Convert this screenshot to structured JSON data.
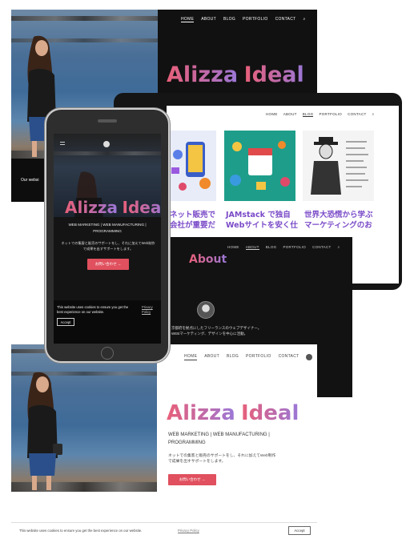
{
  "brand": {
    "first": "Alizza",
    "second": "Ideal"
  },
  "nav": {
    "home": "HOME",
    "about": "ABOUT",
    "blog": "BLOG",
    "portfolio": "PORTFOLIO",
    "contact": "CONTACT"
  },
  "desktop_top": {
    "strip_text": "Our websi"
  },
  "tablet": {
    "cards": [
      {
        "title": "ネット販売で\n会社が重要だ"
      },
      {
        "title": "JAMstack で独自\nWebサイトを安く仕"
      },
      {
        "title": "世界大恐慌から学ぶ\nマーケティングのお"
      }
    ]
  },
  "about": {
    "heading": "About",
    "body": "京都府を拠点にしたフリーランスのウェブデザイナー。\nWEBマーケティング、デザインを中心に活動。"
  },
  "phone": {
    "tagline": "WEB MARKETING | WEB MANUFACTURING | PROGRAMMING",
    "subtext": "ネットでの集客と販売のサポートをし、それに加えてWeb制作\nで成果を出すサポートをします。",
    "cta": "お問い合わせ →",
    "cookie_text": "This website uses cookies to ensure you get the best experience on our website.",
    "cookie_link": "Privacy Policy",
    "cookie_accept": "Accept"
  },
  "desktop_bottom": {
    "tagline": "WEB MARKETING | WEB MANUFACTURING | PROGRAMMING",
    "subtext": "ネットでの集客と販売のサポートをし、それに加えてWeb制作\nで成果を出すサポートをします。",
    "cta": "お問い合わせ →",
    "cookie_text": "This website uses cookies to ensure you get the best experience on our website.",
    "cookie_link": "Privacy Policy",
    "cookie_accept": "Accept"
  },
  "colors": {
    "accent": "#e0505e",
    "dark": "#121212",
    "grad_start": "#e8607a",
    "grad_end": "#9a78d8"
  }
}
